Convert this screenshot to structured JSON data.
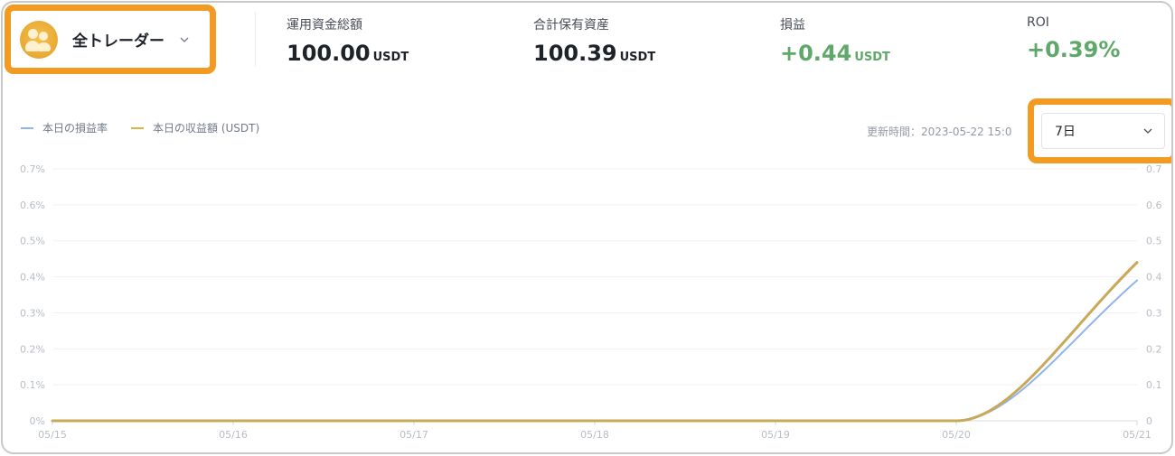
{
  "header": {
    "trader_select": {
      "label": "全トレーダー",
      "icon": "users-avatar-icon"
    },
    "stats": [
      {
        "label": "運用資金総額",
        "value": "100.00",
        "unit": "USDT",
        "color": "#1e2329"
      },
      {
        "label": "合計保有資産",
        "value": "100.39",
        "unit": "USDT",
        "color": "#1e2329"
      },
      {
        "label": "損益",
        "value": "+0.44",
        "unit": "USDT",
        "color": "#5fa86a"
      },
      {
        "label": "ROI",
        "value": "+0.39%",
        "unit": "",
        "color": "#5fa86a"
      }
    ]
  },
  "chart_controls": {
    "legend": [
      {
        "label": "本日の損益率",
        "color": "#8fb4f2"
      },
      {
        "label": "本日の収益額 (USDT)",
        "color": "#d9b347"
      }
    ],
    "update_time": "更新時間：2023-05-22 15:0",
    "period": {
      "selected": "7日"
    }
  },
  "highlight_color": "#f39a22",
  "chart_data": {
    "type": "line",
    "x": [
      "05/15",
      "05/16",
      "05/17",
      "05/18",
      "05/19",
      "05/20",
      "05/21"
    ],
    "series": [
      {
        "name": "本日の損益率",
        "values": [
          0,
          0,
          0,
          0,
          0,
          0,
          0.39
        ],
        "color": "#8fb4f2"
      },
      {
        "name": "本日の収益額 (USDT)",
        "values": [
          0,
          0,
          0,
          0,
          0,
          0,
          0.44
        ],
        "color": "#c8a95a"
      }
    ],
    "left_axis": {
      "ticks": [
        "0%",
        "0.1%",
        "0.2%",
        "0.3%",
        "0.4%",
        "0.5%",
        "0.6%",
        "0.7%"
      ],
      "ylim": [
        0,
        0.7
      ]
    },
    "right_axis": {
      "ticks": [
        "0",
        "0.1",
        "0.2",
        "0.3",
        "0.4",
        "0.5",
        "0.6",
        "0.7"
      ],
      "ylim": [
        0,
        0.7
      ]
    },
    "grid": true
  }
}
